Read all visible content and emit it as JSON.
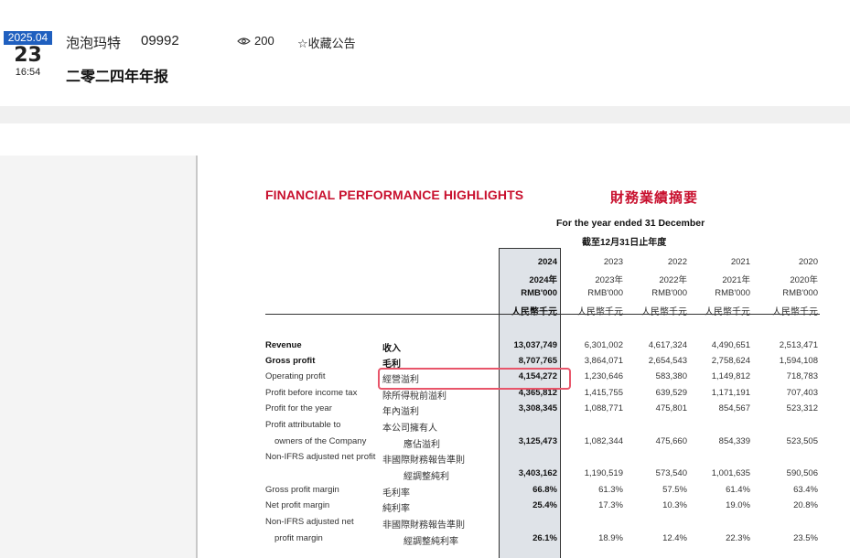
{
  "header": {
    "date_ym": "2025.04",
    "date_day": "23",
    "date_time": "16:54",
    "company": "泡泡玛特",
    "code": "09992",
    "views_icon": "eye-icon",
    "views": "200",
    "favorite_label": "☆收藏公告",
    "doc_title": "二零二四年年报"
  },
  "report": {
    "heading_en": "FINANCIAL PERFORMANCE HIGHLIGHTS",
    "heading_cn": "財務業績摘要",
    "period_en": "For the year ended 31 December",
    "period_cn": "截至12月31日止年度",
    "accent_color": "#c8102e",
    "columns": [
      {
        "year": "2024",
        "year_cn": "2024年",
        "unit": "RMB'000",
        "unit_cn": "人民幣千元"
      },
      {
        "year": "2023",
        "year_cn": "2023年",
        "unit": "RMB'000",
        "unit_cn": "人民幣千元"
      },
      {
        "year": "2022",
        "year_cn": "2022年",
        "unit": "RMB'000",
        "unit_cn": "人民幣千元"
      },
      {
        "year": "2021",
        "year_cn": "2021年",
        "unit": "RMB'000",
        "unit_cn": "人民幣千元"
      },
      {
        "year": "2020",
        "year_cn": "2020年",
        "unit": "RMB'000",
        "unit_cn": "人民幣千元"
      }
    ],
    "rows": [
      {
        "en": "Revenue",
        "cn": "收入",
        "bold": true,
        "values": [
          "13,037,749",
          "6,301,002",
          "4,617,324",
          "4,490,651",
          "2,513,471"
        ]
      },
      {
        "en": "Gross profit",
        "cn": "毛利",
        "bold": true,
        "values": [
          "8,707,765",
          "3,864,071",
          "2,654,543",
          "2,758,624",
          "1,594,108"
        ]
      },
      {
        "en": "Operating profit",
        "cn": "經營溢利",
        "bold": false,
        "values": [
          "4,154,272",
          "1,230,646",
          "583,380",
          "1,149,812",
          "718,783"
        ]
      },
      {
        "en": "Profit before income tax",
        "cn": "除所得稅前溢利",
        "bold": false,
        "values": [
          "4,365,812",
          "1,415,755",
          "639,529",
          "1,171,191",
          "707,403"
        ]
      },
      {
        "en": "Profit for the year",
        "cn": "年內溢利",
        "bold": false,
        "values": [
          "3,308,345",
          "1,088,771",
          "475,801",
          "854,567",
          "523,312"
        ]
      },
      {
        "en": "Profit attributable to",
        "cn": "本公司擁有人",
        "bold": false,
        "values": [
          "",
          "",
          "",
          "",
          ""
        ]
      },
      {
        "en": "owners of the Company",
        "cn": "應佔溢利",
        "bold": false,
        "values": [
          "3,125,473",
          "1,082,344",
          "475,660",
          "854,339",
          "523,505"
        ]
      },
      {
        "en": "Non-IFRS adjusted net profit",
        "cn": "非國際財務報告準則",
        "bold": false,
        "values": [
          "",
          "",
          "",
          "",
          ""
        ]
      },
      {
        "en": "",
        "cn": "經調整純利",
        "bold": false,
        "values": [
          "3,403,162",
          "1,190,519",
          "573,540",
          "1,001,635",
          "590,506"
        ]
      },
      {
        "en": "Gross profit margin",
        "cn": "毛利率",
        "bold": false,
        "values": [
          "66.8%",
          "61.3%",
          "57.5%",
          "61.4%",
          "63.4%"
        ]
      },
      {
        "en": "Net profit margin",
        "cn": "純利率",
        "bold": false,
        "values": [
          "25.4%",
          "17.3%",
          "10.3%",
          "19.0%",
          "20.8%"
        ]
      },
      {
        "en": "Non-IFRS adjusted net",
        "cn": "非國際財務報告準則",
        "bold": false,
        "values": [
          "",
          "",
          "",
          "",
          ""
        ]
      },
      {
        "en": "profit margin",
        "cn": "經調整純利率",
        "bold": false,
        "values": [
          "26.1%",
          "18.9%",
          "12.4%",
          "22.3%",
          "23.5%"
        ]
      }
    ]
  }
}
